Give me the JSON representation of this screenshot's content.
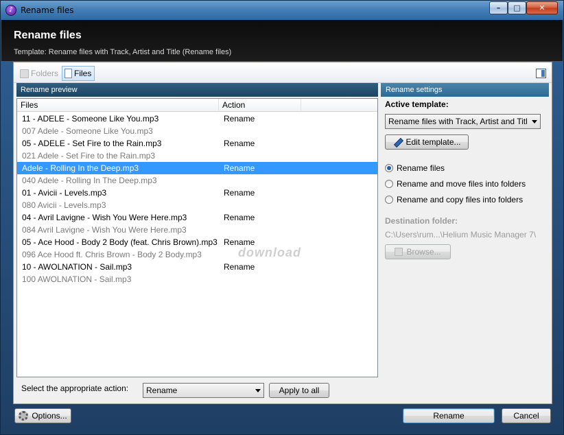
{
  "window": {
    "title": "Rename files"
  },
  "header": {
    "title": "Rename files",
    "subtitle": "Template: Rename files with Track, Artist and Title (Rename files)"
  },
  "toolbar": {
    "folders_label": "Folders",
    "files_label": "Files"
  },
  "preview": {
    "heading": "Rename preview",
    "columns": {
      "files": "Files",
      "action": "Action"
    },
    "rows": [
      {
        "file": "11 - ADELE - Someone Like You.mp3",
        "action": "Rename",
        "kind": "new"
      },
      {
        "file": "007 Adele - Someone Like You.mp3",
        "action": "",
        "kind": "old"
      },
      {
        "file": "05 - ADELE - Set Fire to the Rain.mp3",
        "action": "Rename",
        "kind": "new"
      },
      {
        "file": "021 Adele - Set Fire to the Rain.mp3",
        "action": "",
        "kind": "old"
      },
      {
        "file": "Adele - Rolling In the Deep.mp3",
        "action": "Rename",
        "kind": "selected"
      },
      {
        "file": "040 Adele - Rolling In The Deep.mp3",
        "action": "",
        "kind": "old"
      },
      {
        "file": "01 - Avicii - Levels.mp3",
        "action": "Rename",
        "kind": "new"
      },
      {
        "file": "080 Avicii - Levels.mp3",
        "action": "",
        "kind": "old"
      },
      {
        "file": "04 - Avril Lavigne - Wish You Were Here.mp3",
        "action": "Rename",
        "kind": "new"
      },
      {
        "file": "084 Avril Lavigne - Wish You Were Here.mp3",
        "action": "",
        "kind": "old"
      },
      {
        "file": "05 - Ace Hood - Body 2 Body (feat. Chris Brown).mp3",
        "action": "Rename",
        "kind": "new"
      },
      {
        "file": "096 Ace Hood ft. Chris Brown - Body 2 Body.mp3",
        "action": "",
        "kind": "old"
      },
      {
        "file": "10 - AWOLNATION - Sail.mp3",
        "action": "Rename",
        "kind": "new"
      },
      {
        "file": "100 AWOLNATION - Sail.mp3",
        "action": "",
        "kind": "old"
      }
    ],
    "watermark": "download"
  },
  "settings": {
    "heading": "Rename settings",
    "active_template_label": "Active template:",
    "active_template_value": "Rename files with Track, Artist and Title",
    "edit_template_label": "Edit template...",
    "radio_options": [
      {
        "label": "Rename files",
        "checked": true
      },
      {
        "label": "Rename and move files into folders",
        "checked": false
      },
      {
        "label": "Rename and copy files into folders",
        "checked": false
      }
    ],
    "destination_label": "Destination folder:",
    "destination_path": "C:\\Users\\rum...\\Helium Music Manager 7\\",
    "browse_label": "Browse..."
  },
  "action_bar": {
    "label": "Select the appropriate action:",
    "selected_action": "Rename",
    "apply_all_label": "Apply to all"
  },
  "footer": {
    "options_label": "Options...",
    "rename_label": "Rename",
    "cancel_label": "Cancel"
  }
}
